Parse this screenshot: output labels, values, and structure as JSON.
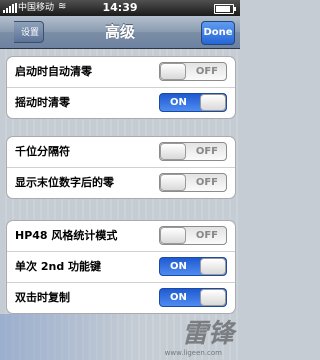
{
  "status_bar": {
    "carrier": "中国移动",
    "time": "14:39"
  },
  "nav": {
    "back_label": "设置",
    "title": "高级",
    "done_label": "Done"
  },
  "groups": [
    {
      "rows": [
        {
          "label": "启动时自动清零",
          "state": "OFF"
        },
        {
          "label": "摇动时清零",
          "state": "ON"
        }
      ]
    },
    {
      "rows": [
        {
          "label": "千位分隔符",
          "state": "OFF"
        },
        {
          "label": "显示末位数字后的零",
          "state": "OFF"
        }
      ]
    },
    {
      "rows": [
        {
          "label": "HP48 风格统计模式",
          "state": "OFF"
        },
        {
          "label": "单次 2nd 功能键",
          "state": "ON"
        },
        {
          "label": "双击时复制",
          "state": "ON"
        }
      ]
    }
  ],
  "watermark": {
    "logo": "雷锋",
    "url": "www.ligeen.com"
  },
  "colors": {
    "switch_on": "#2a6ee0",
    "nav_bar": "#6d82a1",
    "done_button": "#2466d6"
  }
}
